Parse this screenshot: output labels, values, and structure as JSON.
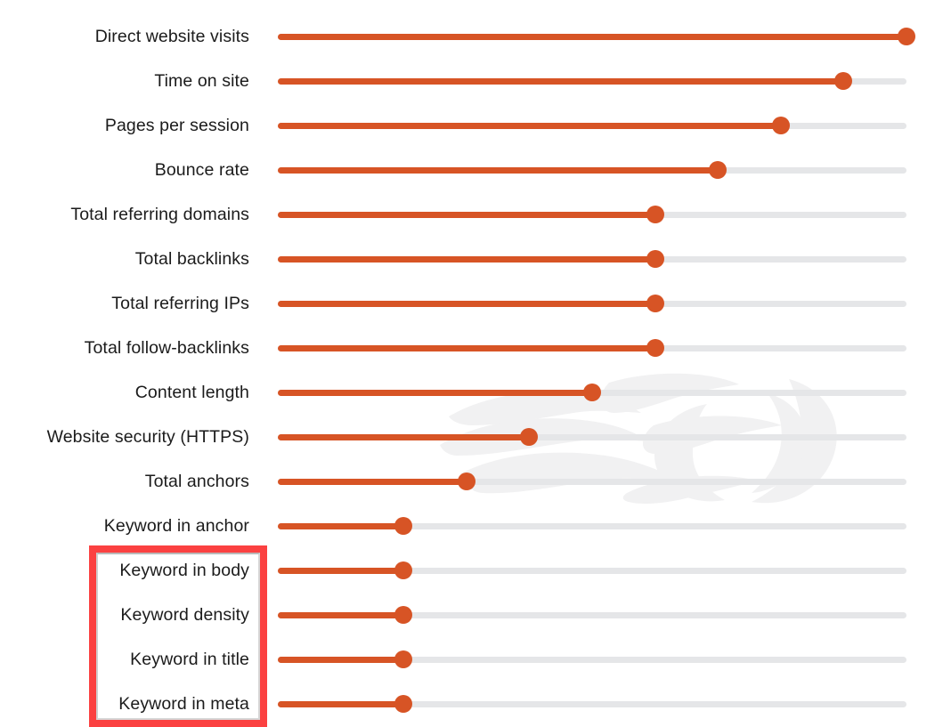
{
  "chart_data": {
    "type": "bar",
    "orientation": "horizontal",
    "style": "lollipop",
    "title": "",
    "subtitle": "",
    "xlabel": "",
    "ylabel": "",
    "grid": false,
    "legend": null,
    "xlim": [
      0,
      100
    ],
    "axis_ticks": [],
    "track_color": "#e5e6e8",
    "accent_color": "#d75425",
    "categories": [
      "Direct website visits",
      "Time on site",
      "Pages per session",
      "Bounce rate",
      "Total referring domains",
      "Total backlinks",
      "Total referring IPs",
      "Total follow-backlinks",
      "Content length",
      "Website security (HTTPS)",
      "Total anchors",
      "Keyword in anchor",
      "Keyword in body",
      "Keyword density",
      "Keyword in title",
      "Keyword in meta"
    ],
    "values": [
      100,
      90,
      80,
      70,
      60,
      60,
      60,
      60,
      50,
      40,
      30,
      20,
      20,
      20,
      20,
      20
    ]
  },
  "annotation": {
    "highlight_box": {
      "color": "#fb4141",
      "covers": [
        "Keyword in body",
        "Keyword density",
        "Keyword in title",
        "Keyword in meta"
      ]
    }
  },
  "watermark": {
    "name": "flame-ring-logo-watermark",
    "color": "#f2f2f2"
  }
}
